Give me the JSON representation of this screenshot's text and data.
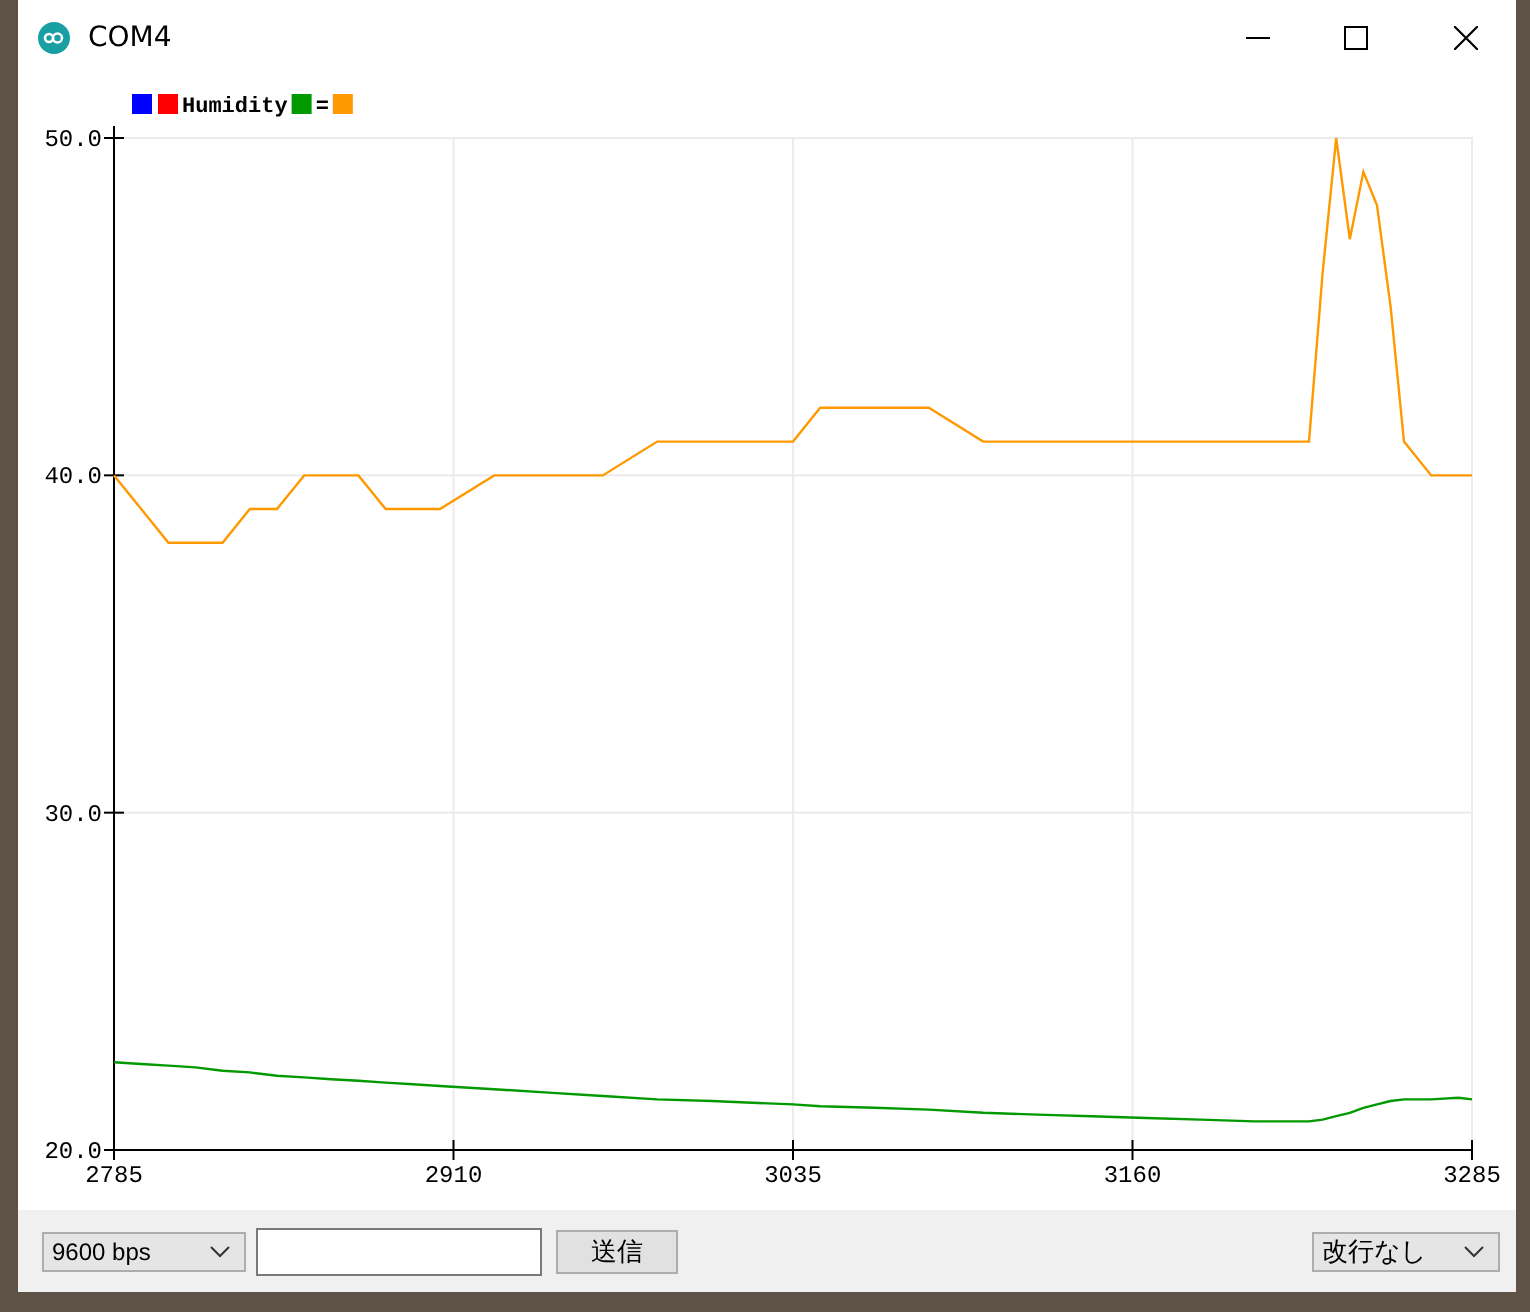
{
  "window": {
    "title": "COM4"
  },
  "plot": {
    "chart_data": {
      "type": "line",
      "x": [
        2785,
        2795,
        2805,
        2815,
        2825,
        2835,
        2845,
        2855,
        2865,
        2875,
        2885,
        2895,
        2905,
        2925,
        2945,
        2965,
        2985,
        3005,
        3035,
        3045,
        3065,
        3085,
        3105,
        3125,
        3145,
        3165,
        3185,
        3205,
        3225,
        3230,
        3235,
        3240,
        3245,
        3250,
        3255,
        3260,
        3270,
        3280,
        3285
      ],
      "series": [
        {
          "color": "#0000ff",
          "values": [
            null,
            null,
            null,
            null,
            null,
            null,
            null,
            null,
            null,
            null,
            null,
            null,
            null,
            null,
            null,
            null,
            null,
            null,
            null,
            null,
            null,
            null,
            null,
            null,
            null,
            null,
            null,
            null,
            null,
            null,
            null,
            null,
            null,
            null,
            null,
            null,
            null,
            null,
            null
          ]
        },
        {
          "name": "Humidity",
          "color": "#ff0000",
          "values": [
            null,
            null,
            null,
            null,
            null,
            null,
            null,
            null,
            null,
            null,
            null,
            null,
            null,
            null,
            null,
            null,
            null,
            null,
            null,
            null,
            null,
            null,
            null,
            null,
            null,
            null,
            null,
            null,
            null,
            null,
            null,
            null,
            null,
            null,
            null,
            null,
            null,
            null,
            null
          ]
        },
        {
          "name": "=",
          "color": "#009900",
          "values": [
            22.6,
            22.55,
            22.5,
            22.45,
            22.35,
            22.3,
            22.2,
            22.15,
            22.1,
            22.05,
            22.0,
            21.95,
            21.9,
            21.8,
            21.7,
            21.6,
            21.5,
            21.45,
            21.35,
            21.3,
            21.25,
            21.2,
            21.1,
            21.05,
            21.0,
            20.95,
            20.9,
            20.85,
            20.85,
            20.9,
            21.0,
            21.1,
            21.25,
            21.35,
            21.45,
            21.5,
            21.5,
            21.55,
            21.5
          ]
        },
        {
          "color": "#ff9900",
          "values": [
            40,
            39,
            38,
            38,
            38,
            39,
            39,
            40,
            40,
            40,
            39,
            39,
            39,
            40,
            40,
            40,
            41,
            41,
            41,
            42,
            42,
            42,
            41,
            41,
            41,
            41,
            41,
            41,
            41,
            46,
            50,
            47,
            49,
            48,
            45,
            41,
            40,
            40,
            40
          ]
        }
      ],
      "grid": true,
      "xlim": [
        2785,
        3285
      ],
      "ylim": [
        20,
        50
      ],
      "xticks": [
        2785,
        2910,
        3035,
        3160,
        3285
      ],
      "yticks": [
        {
          "value": 20,
          "label": "20.0"
        },
        {
          "value": 30,
          "label": "30.0"
        },
        {
          "value": 40,
          "label": "40.0"
        },
        {
          "value": 50,
          "label": "50.0"
        }
      ]
    }
  },
  "bottom_bar": {
    "baud_rate": "9600 bps",
    "send_button": "送信",
    "line_ending": "改行なし"
  }
}
